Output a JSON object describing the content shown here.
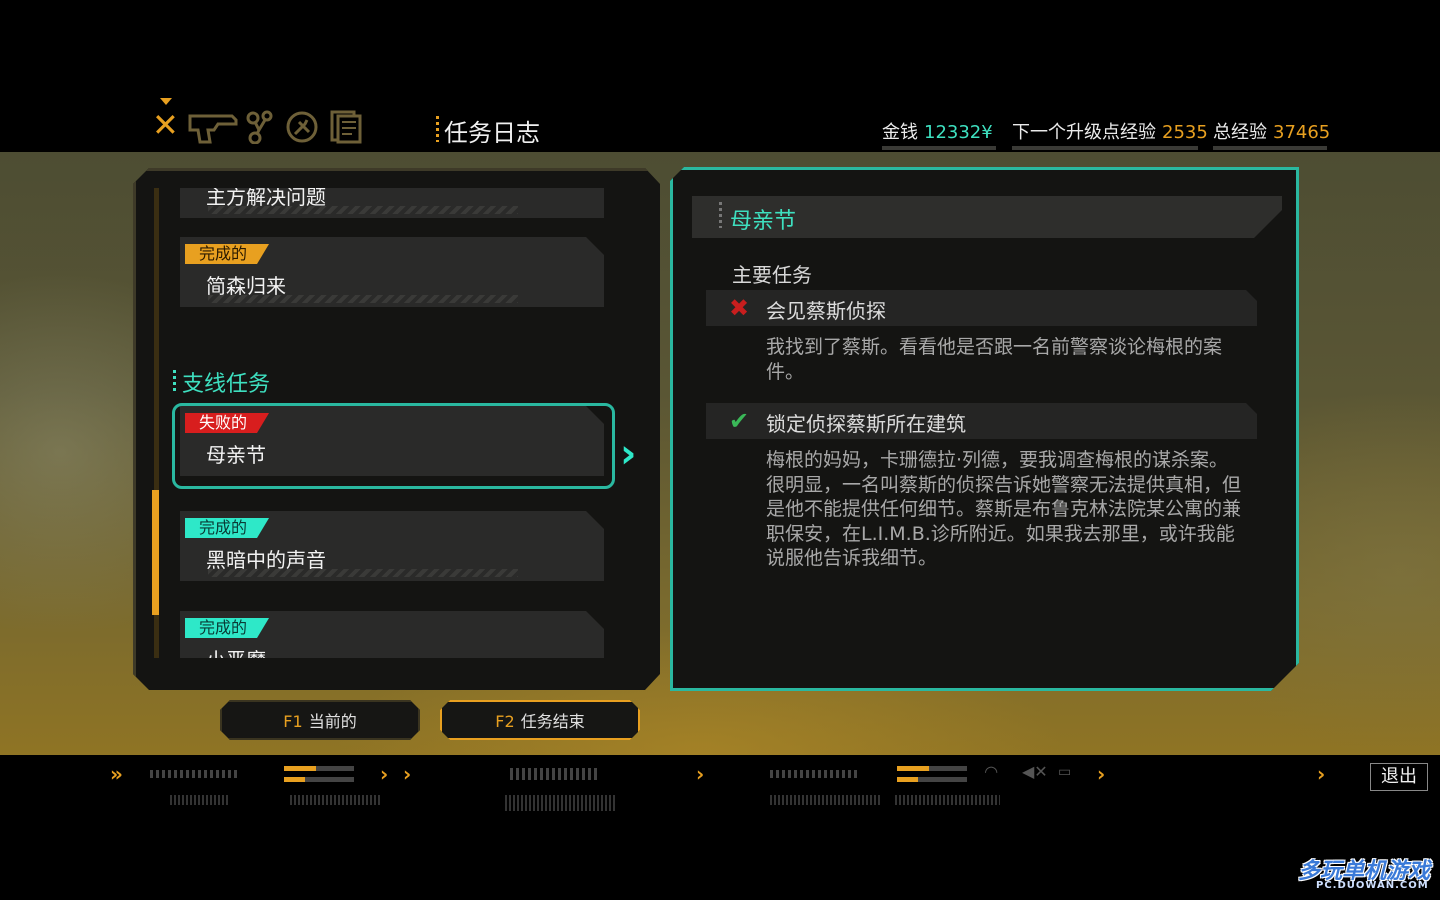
{
  "header": {
    "title": "任务日志",
    "nav_icons": [
      "quest-log-icon",
      "weapon-icon",
      "augmentation-icon",
      "map-icon",
      "documents-icon"
    ],
    "stats": {
      "money_label": "金钱",
      "money_value": "12332¥",
      "next_label": "下一个升级点经验",
      "next_value": "2535",
      "total_label": "总经验",
      "total_value": "37465"
    }
  },
  "quest_list": {
    "partial_top_name": "主方解决问题",
    "items": [
      {
        "status": "完成的",
        "name": "简森归来"
      },
      {
        "status": "失败的",
        "name": "母亲节"
      },
      {
        "status": "完成的",
        "name": "黑暗中的声音"
      },
      {
        "status": "完成的",
        "name": "小恶魔"
      }
    ],
    "section_side": "支线任务",
    "selected_index": 1
  },
  "tabs": [
    {
      "key": "F1",
      "label": "当前的"
    },
    {
      "key": "F2",
      "label": "任务结束"
    }
  ],
  "detail": {
    "title": "母亲节",
    "main_task_label": "主要任务",
    "objectives": [
      {
        "status": "failed",
        "title": "会见蔡斯侦探",
        "desc": "我找到了蔡斯。看看他是否跟一名前警察谈论梅根的案件。"
      },
      {
        "status": "completed",
        "title": "锁定侦探蔡斯所在建筑",
        "desc": "梅根的妈妈，卡珊德拉·列德，要我调查梅根的谋杀案。很明显，一名叫蔡斯的侦探告诉她警察无法提供真相，但是他不能提供任何细节。蔡斯是布鲁克林法院某公寓的兼职保安，在L.I.M.B.诊所附近。如果我去那里，或许我能说服他告诉我细节。"
      }
    ]
  },
  "hud": {
    "exit_label": "退出",
    "bars": [
      0.45,
      0.3
    ]
  },
  "watermark": {
    "text": "多玩单机游戏",
    "url": "PC.DUOWAN.COM"
  },
  "colors": {
    "accent_orange": "#e8a020",
    "accent_teal": "#2ee8c8",
    "failed_red": "#d81e1e",
    "panel_bg": "#141412"
  }
}
